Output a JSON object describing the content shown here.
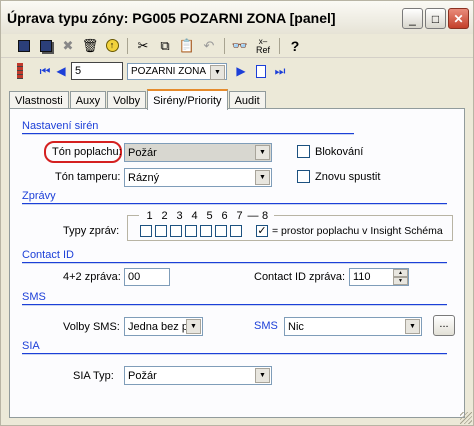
{
  "window": {
    "title": "Úprava typu zóny: PG005 POZARNI ZONA [panel]"
  },
  "nav": {
    "record_number": "5",
    "zone_select": "POZARNI ZONA"
  },
  "tabs": [
    "Vlastnosti",
    "Auxy",
    "Volby",
    "Sirény/Priority",
    "Audit"
  ],
  "toolbar": {
    "ref_label": "Ref"
  },
  "sections": {
    "sirens": "Nastavení sirén",
    "messages": "Zprávy",
    "contactid": "Contact ID",
    "sms": "SMS",
    "sia": "SIA"
  },
  "sirens": {
    "alarm_tone_label": "Tón poplachu:",
    "alarm_tone_value": "Požár",
    "tamper_tone_label": "Tón tamperu:",
    "tamper_tone_value": "Rázný",
    "block_label": "Blokování",
    "restart_label": "Znovu spustit"
  },
  "messages": {
    "types_label": "Typy zpráv:",
    "numbers": [
      "1",
      "2",
      "3",
      "4",
      "5",
      "6",
      "7",
      "8"
    ],
    "alarm_area_label": "= prostor poplachu v Insight Schéma"
  },
  "contactid": {
    "four_two_label": "4+2 zpráva:",
    "four_two_value": "00",
    "cid_label": "Contact ID zpráva:",
    "cid_value": "110"
  },
  "sms": {
    "options_label": "Volby SMS:",
    "options_value": "Jedna bez p",
    "sms_label": "SMS",
    "sms_value": "Nic",
    "browse_label": "..."
  },
  "sia": {
    "type_label": "SIA Typ:",
    "type_value": "Požár"
  },
  "colors": {
    "accent": "#1c3fd8",
    "highlight": "#d42020",
    "tab_active": "#e68b2c"
  }
}
